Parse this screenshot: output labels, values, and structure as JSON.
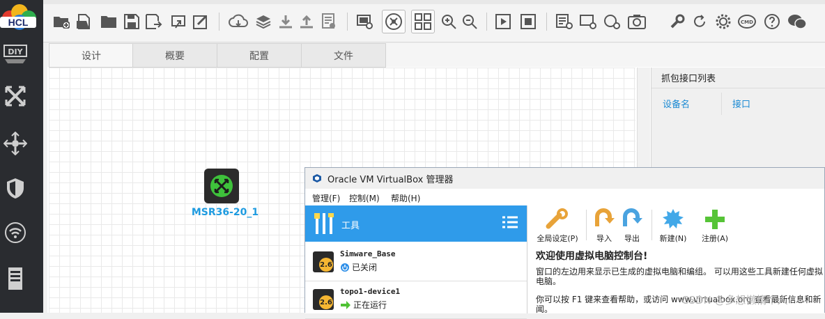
{
  "app": {
    "logo_text": "HCL"
  },
  "sidebar": {
    "items": [
      "diy-icon",
      "switch-icon",
      "router-icon",
      "firewall-icon",
      "wireless-icon",
      "server-icon"
    ]
  },
  "toolbar": {
    "icons": [
      "new-folder-icon",
      "open-file-icon",
      "open-folder-icon",
      "save-icon",
      "save-as-icon",
      "export-icon",
      "edit-icon",
      "cloud-icon",
      "layers-icon",
      "download-icon",
      "upload-icon",
      "log-icon",
      "screenshot-icon",
      "hub-icon",
      "grid-icon",
      "zoom-in-icon",
      "zoom-out-icon",
      "play-icon",
      "stop-icon",
      "add-list-icon",
      "add-window-icon",
      "add-circle-icon",
      "camera-icon",
      "wrench-icon",
      "refresh-icon",
      "gear-icon",
      "cmd-icon",
      "help-icon",
      "wechat-icon"
    ],
    "cmd_label": "CMD"
  },
  "tabs": [
    "设计",
    "概要",
    "配置",
    "文件"
  ],
  "canvas": {
    "device_label": "MSR36-20_1"
  },
  "capture_panel": {
    "title": "抓包接口列表",
    "col_device": "设备名",
    "col_interface": "接口"
  },
  "virtualbox": {
    "title": "Oracle VM VirtualBox 管理器",
    "menu": [
      "管理(F)",
      "控制(M)",
      "帮助(H)"
    ],
    "tools_label": "工具",
    "vms": [
      {
        "name": "Simware_Base",
        "state": "已关闭",
        "version": "2.6"
      },
      {
        "name": "topo1-device1",
        "state": "正在运行",
        "version": "2.6"
      }
    ],
    "actions": [
      "全局设定(P)",
      "导入",
      "导出",
      "新建(N)",
      "注册(A)"
    ],
    "welcome_title": "欢迎使用虚拟电脑控制台!",
    "welcome_p1": "窗口的左边用来显示已生成的虚拟电脑和编组。 可以用这些工具新建任何虚拟电脑。",
    "welcome_p2": "你可以按 F1 键来查看帮助，或访问 www.virtualbox.org 查看最新信息和新闻。"
  },
  "watermark": "CSDN @多想懒惰个人"
}
